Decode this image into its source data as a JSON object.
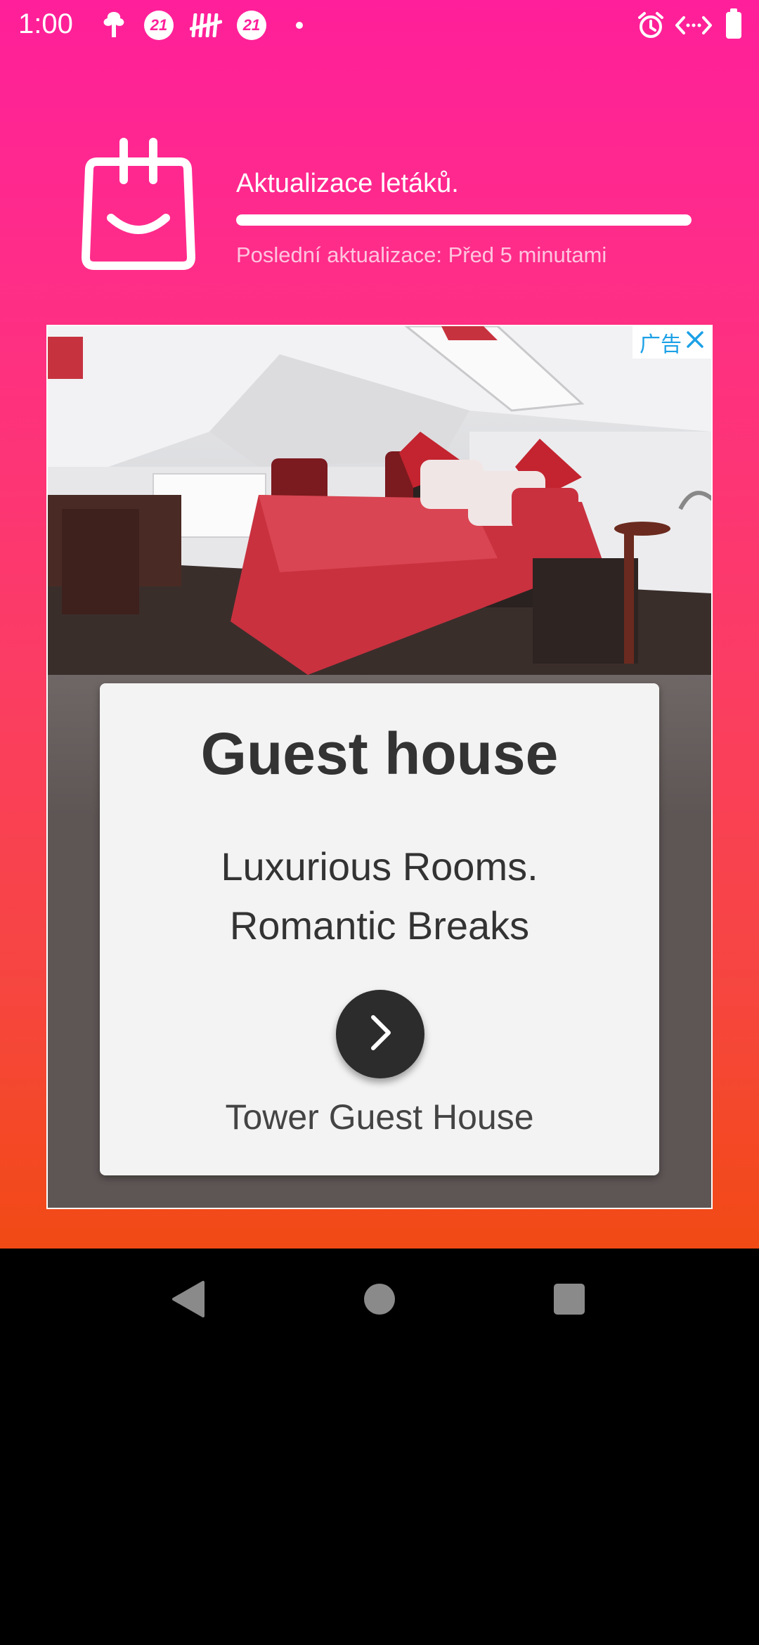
{
  "status_bar": {
    "time": "1:00",
    "badge_1": "21",
    "badge_2": "21",
    "icons": [
      "tree-icon",
      "badge-21-icon",
      "tally-icon",
      "badge-21-icon",
      "dot-icon",
      "alarm-icon",
      "nfc-icon",
      "battery-icon"
    ]
  },
  "header": {
    "title": "Aktualizace letáků.",
    "subtitle": "Poslední aktualizace: Před 5 minutami",
    "progress": 1.0
  },
  "ad": {
    "choices_label": "广告",
    "title": "Guest house",
    "line_1": "Luxurious Rooms.",
    "line_2": "Romantic Breaks",
    "brand": "Tower Guest House"
  },
  "colors": {
    "gradient_top": "#ff1f9a",
    "gradient_bottom": "#f24a14",
    "adchoices_blue": "#1ca1e6"
  },
  "nav": {
    "icons": [
      "back-icon",
      "home-icon",
      "recents-icon"
    ]
  }
}
